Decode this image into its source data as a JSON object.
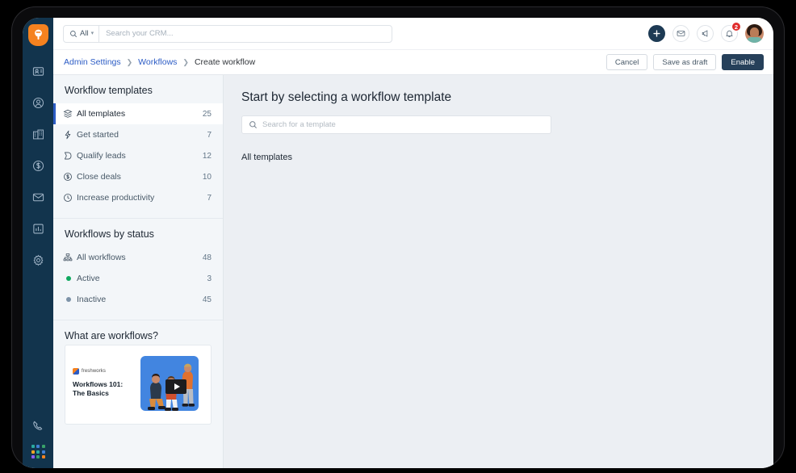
{
  "app": {
    "brand": "freshworks",
    "accent_orange": "#f5821f",
    "accent_blue": "#2c5cc5",
    "rail_bg": "#12344d"
  },
  "topbar": {
    "search": {
      "scope_label": "All",
      "scope_icon": "search-icon",
      "caret_icon": "chevron-down-icon",
      "placeholder": "Search your CRM..."
    },
    "actions": [
      {
        "name": "add-button",
        "icon": "plus-icon"
      },
      {
        "name": "email-button",
        "icon": "envelope-icon"
      },
      {
        "name": "announcement-button",
        "icon": "megaphone-icon"
      },
      {
        "name": "notifications-button",
        "icon": "bell-icon",
        "badge": "2",
        "badge_color": "#e02c2c"
      }
    ],
    "avatar_name": "user-avatar"
  },
  "breadcrumb": {
    "items": [
      {
        "label": "Admin Settings",
        "link": true
      },
      {
        "label": "Workflows",
        "link": true
      },
      {
        "label": "Create workflow",
        "link": false
      }
    ],
    "separator": "›"
  },
  "page_actions": {
    "cancel_label": "Cancel",
    "save_draft_label": "Save as draft",
    "enable_label": "Enable",
    "enable_color": "#26405a"
  },
  "sidebar_rail": {
    "items": [
      {
        "name": "sidebar-item-logo",
        "icon": "freshworks-logo-icon"
      },
      {
        "name": "sidebar-item-notes",
        "icon": "contact-card-icon"
      },
      {
        "name": "sidebar-item-contacts",
        "icon": "person-circle-icon"
      },
      {
        "name": "sidebar-item-accounts",
        "icon": "building-icon"
      },
      {
        "name": "sidebar-item-deals",
        "icon": "dollar-circle-icon"
      },
      {
        "name": "sidebar-item-email",
        "icon": "envelope-icon"
      },
      {
        "name": "sidebar-item-reports",
        "icon": "bar-chart-icon"
      },
      {
        "name": "sidebar-item-settings",
        "icon": "gear-icon"
      }
    ],
    "bottom_items": [
      {
        "name": "sidebar-item-phone",
        "icon": "phone-icon"
      },
      {
        "name": "sidebar-item-marketplace",
        "icon": "app-grid-icon"
      }
    ]
  },
  "panel": {
    "templates": {
      "title": "Workflow templates",
      "items": [
        {
          "label": "All templates",
          "count": "25",
          "icon": "layers-icon",
          "active": true
        },
        {
          "label": "Get started",
          "count": "7",
          "icon": "lightning-icon",
          "active": false
        },
        {
          "label": "Qualify leads",
          "count": "12",
          "icon": "funnel-icon",
          "active": false
        },
        {
          "label": "Close deals",
          "count": "10",
          "icon": "dollar-circle-icon",
          "active": false
        },
        {
          "label": "Increase productivity",
          "count": "7",
          "icon": "clock-icon",
          "active": false
        }
      ]
    },
    "status": {
      "title": "Workflows by status",
      "items": [
        {
          "label": "All workflows",
          "count": "48",
          "icon": "hierarchy-icon",
          "dot": null
        },
        {
          "label": "Active",
          "count": "3",
          "icon": "dot",
          "dot": "#0fa85f"
        },
        {
          "label": "Inactive",
          "count": "45",
          "icon": "dot",
          "dot": "#7d93a8"
        }
      ]
    },
    "video": {
      "title": "What are workflows?",
      "brand": "freshworks",
      "video_title_line1": "Workflows 101:",
      "video_title_line2": "The Basics",
      "play_icon": "play-icon"
    }
  },
  "main": {
    "title": "Start by selecting a workflow template",
    "search_placeholder": "Search for a template",
    "search_icon": "search-icon",
    "section_label": "All templates"
  }
}
